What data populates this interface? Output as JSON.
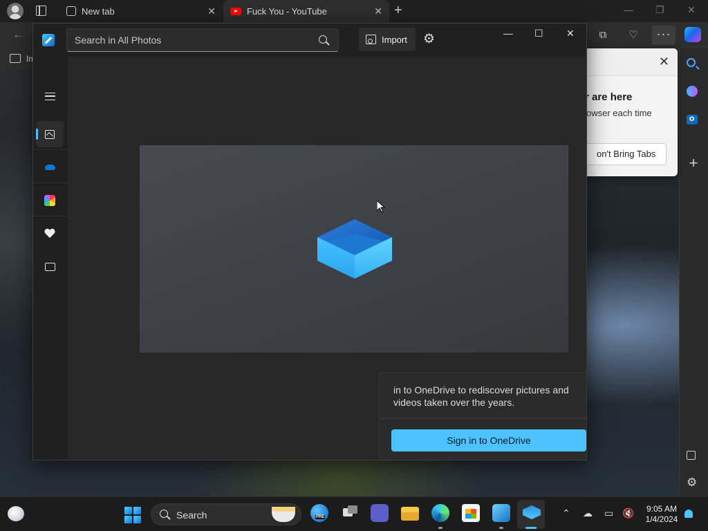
{
  "edge": {
    "tabs": [
      {
        "label": "New tab",
        "favicon": "new-tab-icon"
      },
      {
        "label": "Fuck You - YouTube",
        "favicon": "youtube-icon"
      }
    ],
    "favorites_bar_text": "Im",
    "promo": {
      "title_partial": "r are here",
      "body_partial": "owser each time",
      "button_partial": "on't Bring Tabs"
    }
  },
  "photos": {
    "search_placeholder": "Search in All Photos",
    "import_label": "Import",
    "nav": [
      {
        "name": "menu",
        "icon": "hamburger-icon"
      },
      {
        "name": "all-photos",
        "icon": "gallery-icon",
        "selected": true
      },
      {
        "name": "onedrive",
        "icon": "onedrive-icon"
      },
      {
        "name": "icloud-photos",
        "icon": "icloud-icon"
      },
      {
        "name": "favorites",
        "icon": "heart-icon"
      },
      {
        "name": "folders",
        "icon": "folder-icon"
      }
    ],
    "onedrive_card": {
      "text": "in to OneDrive to rediscover pictures and videos taken over the years.",
      "button_label": "Sign in to OneDrive"
    }
  },
  "taskbar": {
    "search_label": "Search",
    "clock_time": "9:05 AM",
    "clock_date": "1/4/2024",
    "apps": [
      "edge-beta-icon",
      "task-view-icon",
      "teams-icon",
      "file-explorer-icon",
      "edge-icon",
      "store-icon",
      "photos-icon",
      "dropbox-icon"
    ]
  },
  "colors": {
    "accent": "#4cc2ff",
    "window_bg": "#272727",
    "titlebar_bg": "#202020"
  }
}
